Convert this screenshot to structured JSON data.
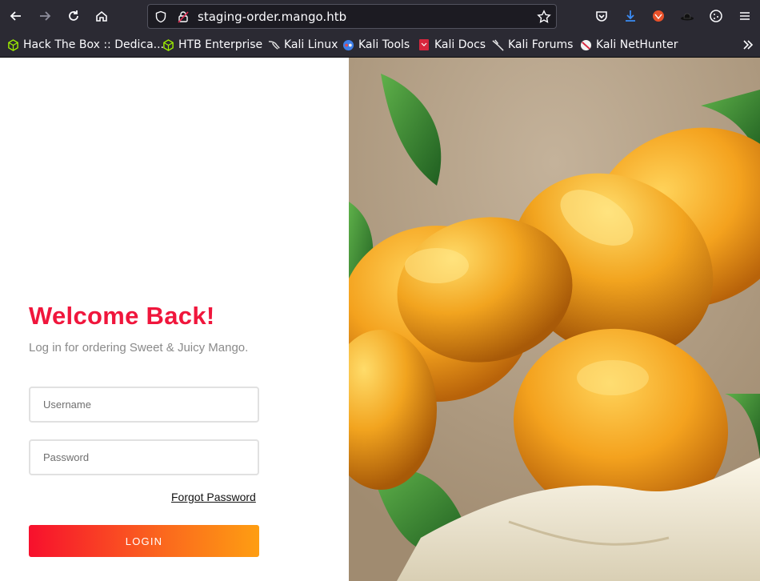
{
  "browser": {
    "url": "staging-order.mango.htb",
    "bookmarks": [
      {
        "label": "Hack The Box :: Dedica...",
        "icon": "htb-cube-icon"
      },
      {
        "label": "HTB Enterprise",
        "icon": "htb-cube-icon"
      },
      {
        "label": "Kali Linux",
        "icon": "kali-dragon-icon"
      },
      {
        "label": "Kali Tools",
        "icon": "kali-tools-icon"
      },
      {
        "label": "Kali Docs",
        "icon": "kali-docs-icon"
      },
      {
        "label": "Kali Forums",
        "icon": "kali-forums-icon"
      },
      {
        "label": "Kali NetHunter",
        "icon": "kali-nethunter-icon"
      }
    ]
  },
  "login": {
    "title": "Welcome Back!",
    "subtitle": "Log in for ordering Sweet & Juicy Mango.",
    "username_placeholder": "Username",
    "password_placeholder": "Password",
    "forgot_label": "Forgot Password",
    "login_label": "LOGIN"
  },
  "colors": {
    "accent": "#f0163c",
    "gradient_start": "#f7102d",
    "gradient_end": "#fe9e12"
  }
}
